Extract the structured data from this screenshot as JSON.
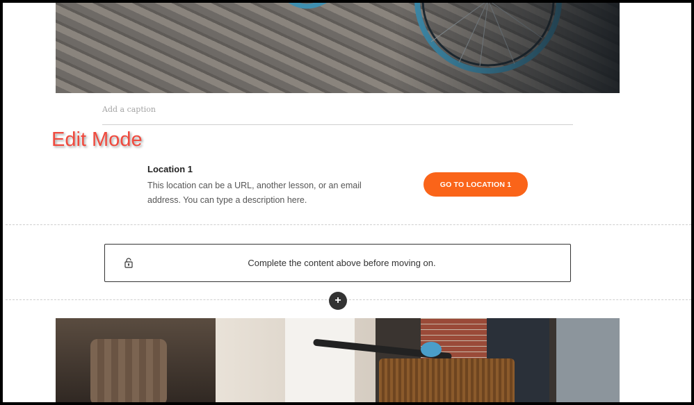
{
  "caption": {
    "placeholder": "Add a caption"
  },
  "annotation": {
    "label": "Edit Mode",
    "color": "#f04a3e"
  },
  "location": {
    "title": "Location 1",
    "description": "This location can be a URL, another lesson, or an email address. You can type a description here.",
    "button_label": "GO TO LOCATION 1",
    "button_color": "#fa6419"
  },
  "gate": {
    "message": "Complete the content above before moving on.",
    "icon": "lock-icon"
  },
  "insert": {
    "label": "+",
    "icon": "plus-icon"
  },
  "images": {
    "top": "bicycle-wheel-photo",
    "bottom": "bicycle-basket-photo"
  }
}
